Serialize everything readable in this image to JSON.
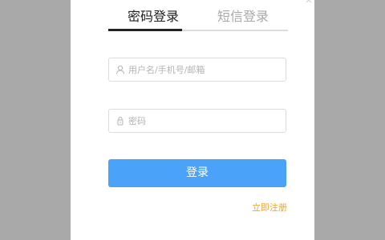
{
  "tabs": {
    "password_login": "密码登录",
    "sms_login": "短信登录",
    "active": "password_login"
  },
  "username": {
    "placeholder": "用户名/手机号/邮箱",
    "value": "",
    "icon": "user-icon"
  },
  "password": {
    "placeholder": "密码",
    "value": "",
    "icon": "lock-icon"
  },
  "login_button": {
    "label": "登录"
  },
  "register_link": {
    "label": "立即注册"
  },
  "colors": {
    "accent": "#4aa3f9",
    "link": "#f0a626",
    "active_tab": "#222222",
    "inactive_tab": "#a8a8a8",
    "backdrop": "#a9a9a9"
  }
}
